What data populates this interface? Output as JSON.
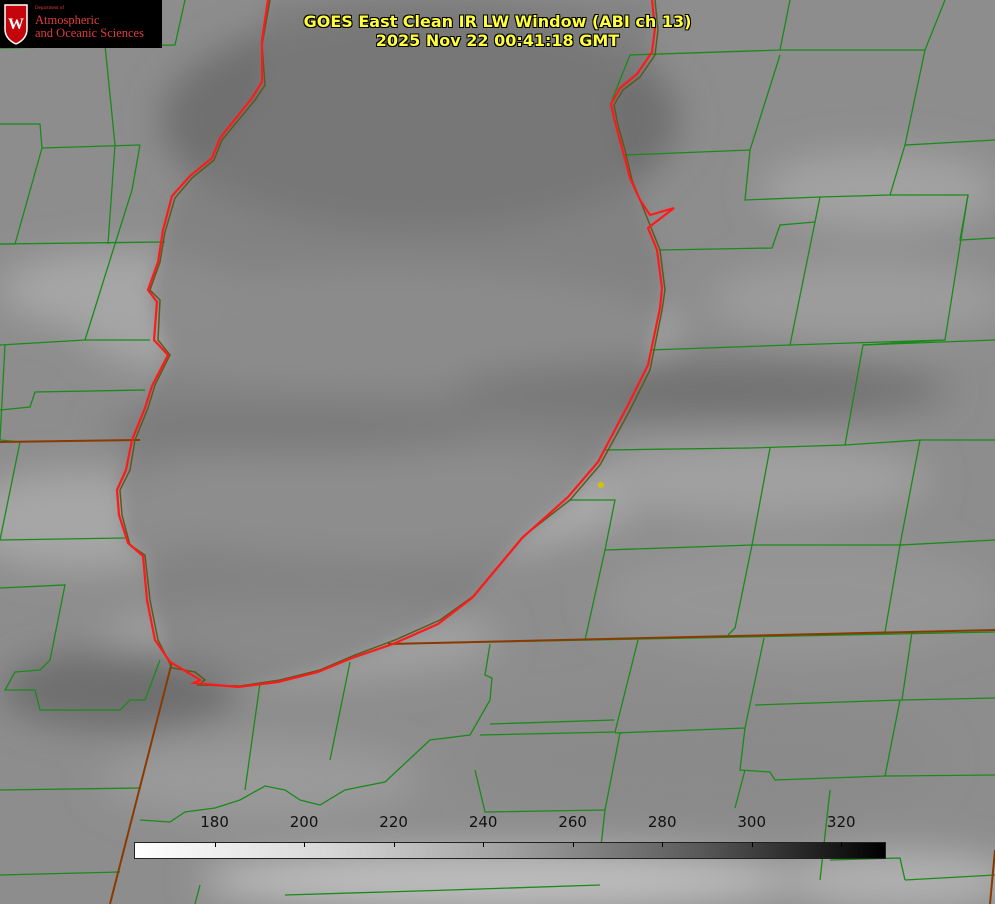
{
  "title": {
    "line1": "GOES East Clean IR LW Window (ABI ch 13)",
    "line2": "2025 Nov 22 00:41:18 GMT"
  },
  "logo": {
    "department": "Department of",
    "line1": "Atmospheric",
    "line2": "and Oceanic Sciences",
    "seal_letter": "W",
    "accent_color": "#e23b3b"
  },
  "map": {
    "lake_outline_color": "#ff1a1a",
    "coast_color": "#8a3a00",
    "county_line_color": "#1a8a1a",
    "marker_color": "#d2c400"
  },
  "colorbar": {
    "units_ticks": [
      "180",
      "200",
      "220",
      "240",
      "260",
      "280",
      "300",
      "320"
    ],
    "min": 162,
    "max": 330
  }
}
